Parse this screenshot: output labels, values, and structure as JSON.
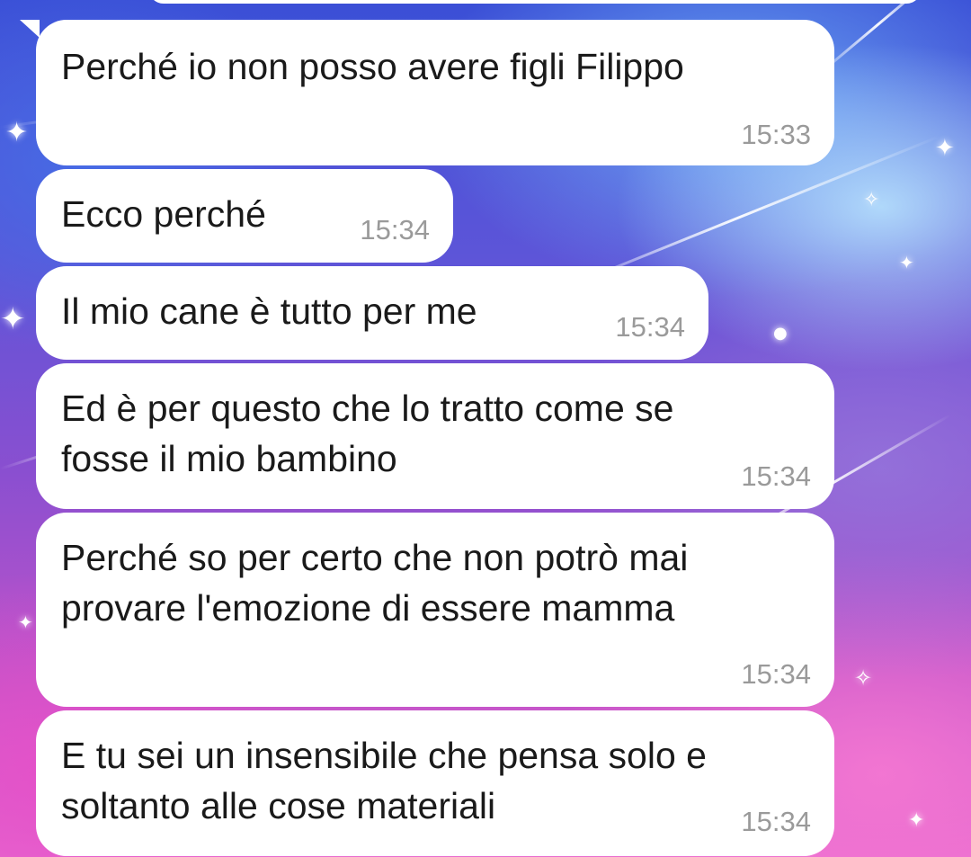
{
  "chat": {
    "messages": [
      {
        "text": "Perché io non posso avere figli Filippo",
        "time": "15:33"
      },
      {
        "text": "Ecco perché",
        "time": "15:34"
      },
      {
        "text": "Il mio cane è tutto per me",
        "time": "15:34"
      },
      {
        "text": "Ed è per questo che lo tratto come se\nfosse il mio bambino",
        "time": "15:34"
      },
      {
        "text": "Perché so per certo che non potrò mai\nprovare l'emozione di essere mamma",
        "time": "15:34"
      },
      {
        "text": "E tu sei un insensibile che pensa solo e\nsoltanto alle cose materiali",
        "time": "15:34"
      }
    ]
  },
  "colors": {
    "bubble": "#ffffff",
    "text": "#1a1a1a",
    "timestamp": "#9a9a9a"
  }
}
